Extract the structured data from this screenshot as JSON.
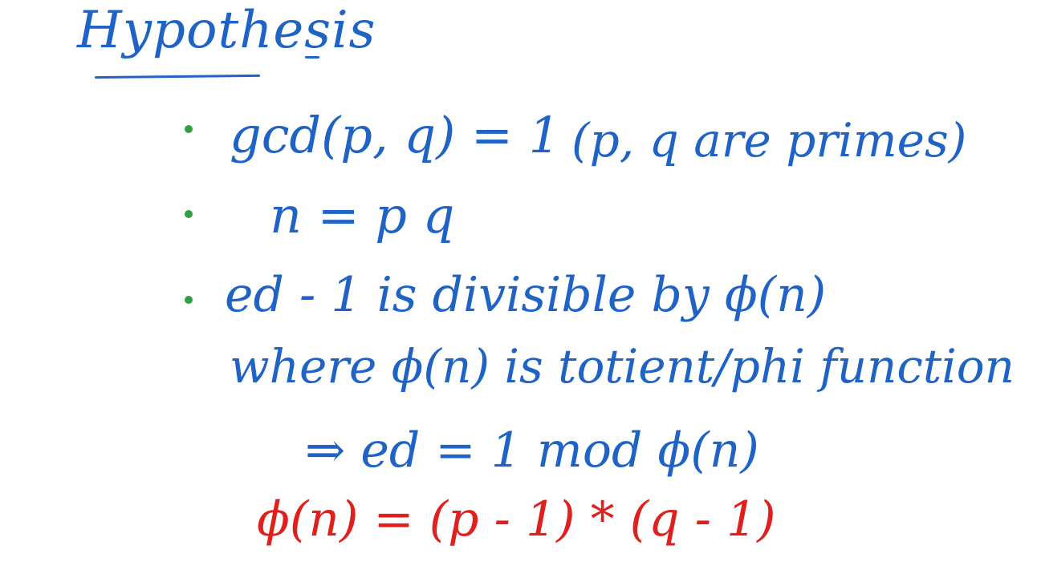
{
  "note": {
    "title": "Hypothesis",
    "title_suffix": "-",
    "bullets": [
      {
        "main": "gcd(p, q) = 1",
        "aside": "(p, q are primes)"
      },
      {
        "main": "n = p q"
      },
      {
        "main": "ed - 1 is divisible by ϕ(n)"
      }
    ],
    "continuation": "where ϕ(n) is totient/phi function",
    "implication": "⇒  ed = 1 mod ϕ(n)",
    "formula": "ϕ(n) = (p - 1) * (q - 1)"
  },
  "colors": {
    "ink_blue": "#1f63c6",
    "ink_red": "#e0201c",
    "bullet_green": "#2ea043",
    "background": "#ffffff"
  }
}
